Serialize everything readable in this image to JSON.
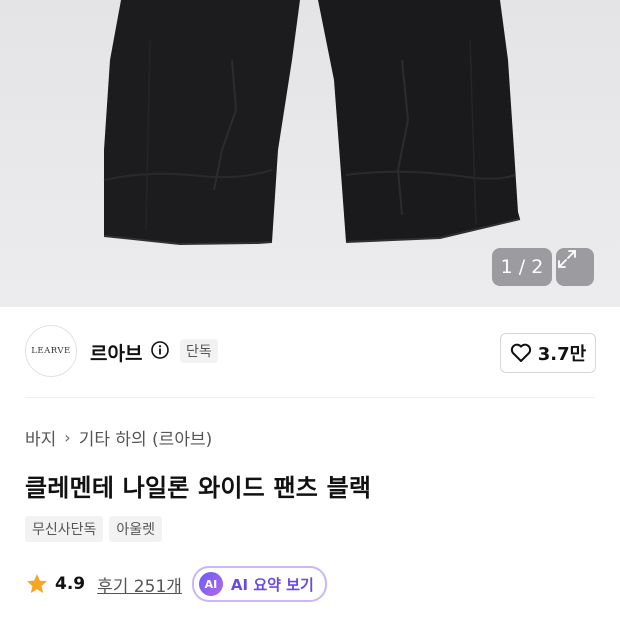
{
  "gallery": {
    "counter": "1 / 2",
    "image_description_icon": "pants-image",
    "expand_icon": "expand-icon"
  },
  "brand": {
    "logo_text": "LEARVE",
    "name": "르아브",
    "exclusive_badge": "단독",
    "like_count": "3.7만"
  },
  "breadcrumb": {
    "items": [
      "바지",
      "기타 하의 (르아브)"
    ]
  },
  "product": {
    "title": "클레멘테 나일론 와이드 팬츠 블랙",
    "tags": [
      "무신사단독",
      "아울렛"
    ],
    "rating": "4.9",
    "reviews": "후기 251개",
    "ai_badge": "AI",
    "ai_summary_label": "AI 요약 보기"
  },
  "colors": {
    "star": "#f5a623",
    "ai_accent": "#6a4be0",
    "ai_border": "#c9b8f5"
  }
}
